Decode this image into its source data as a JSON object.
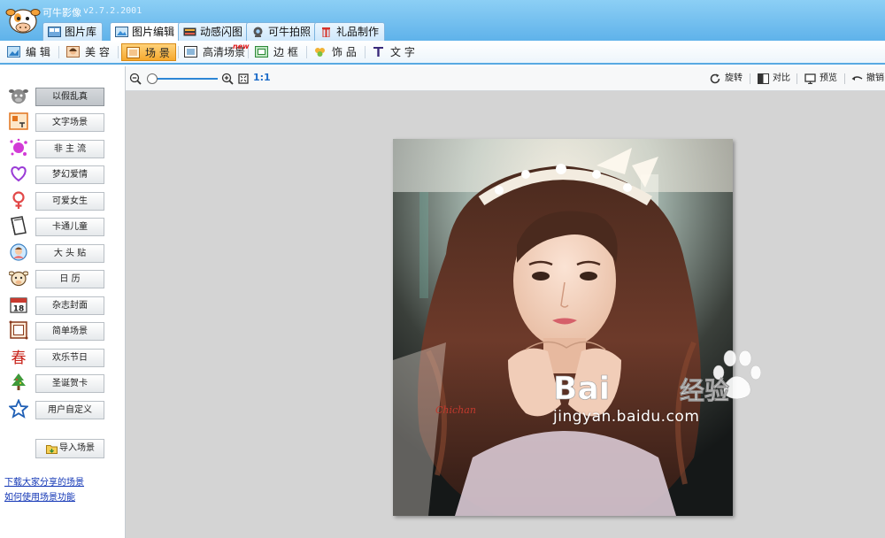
{
  "app": {
    "title": "可牛影像",
    "version": "v2.7.2.2001"
  },
  "main_tabs": [
    {
      "label": "图片库",
      "active": false
    },
    {
      "label": "图片编辑",
      "active": true
    },
    {
      "label": "动感闪图",
      "active": false
    },
    {
      "label": "可牛拍照",
      "active": false
    },
    {
      "label": "礼品制作",
      "active": false
    }
  ],
  "sub_tabs": [
    {
      "label": "编 辑",
      "active": false
    },
    {
      "label": "美 容",
      "active": false
    },
    {
      "label": "场 景",
      "active": true
    },
    {
      "label": "高清场景",
      "active": false
    },
    {
      "label": "边 框",
      "active": false
    },
    {
      "label": "饰 品",
      "active": false
    },
    {
      "label": "文 字",
      "active": false
    }
  ],
  "new_badge": "new",
  "scene_buttons": [
    {
      "label": "以假乱真",
      "icon": "cow-face-icon",
      "active": true
    },
    {
      "label": "文字场景",
      "icon": "text-scene-icon",
      "active": false
    },
    {
      "label": "非 主 流",
      "icon": "splash-icon",
      "active": false
    },
    {
      "label": "梦幻爱情",
      "icon": "heart-icon",
      "active": false
    },
    {
      "label": "可爱女生",
      "icon": "female-icon",
      "active": false
    },
    {
      "label": "卡通儿童",
      "icon": "cartoon-book-icon",
      "active": false
    },
    {
      "label": "大 头 贴",
      "icon": "photo-sticker-icon",
      "active": false
    },
    {
      "label": "日  历",
      "icon": "cow-calendar-icon",
      "active": false
    },
    {
      "label": "杂志封面",
      "icon": "calendar-18-icon",
      "active": false
    },
    {
      "label": "简单场景",
      "icon": "frame-icon",
      "active": false
    },
    {
      "label": "欢乐节日",
      "icon": "spring-festival-icon",
      "active": false
    },
    {
      "label": "圣诞贺卡",
      "icon": "christmas-tree-icon",
      "active": false
    },
    {
      "label": "用户自定义",
      "icon": "star-icon",
      "active": false
    }
  ],
  "import_scene_label": "导入场景",
  "left_links": [
    "下载大家分享的场景",
    "如何使用场景功能"
  ],
  "canvas_toolbar": {
    "zoom_level_label": "1:1",
    "zoom_fraction": 0.0,
    "tools": [
      {
        "label": "旋转",
        "icon": "rotate-icon"
      },
      {
        "label": "对比",
        "icon": "compare-icon"
      },
      {
        "label": "预览",
        "icon": "preview-icon"
      },
      {
        "label": "撤销",
        "icon": "undo-icon"
      }
    ]
  },
  "photo_signature": "Chichan",
  "watermark": {
    "brand_latin": "Bai",
    "brand_cn": "经验",
    "url": "jingyan.baidu.com"
  },
  "colors": {
    "title_bar": "#6cbcf0",
    "active_subtab": "#f6a92e",
    "link": "#1034b5",
    "workspace_bg": "#d4d4d4"
  }
}
